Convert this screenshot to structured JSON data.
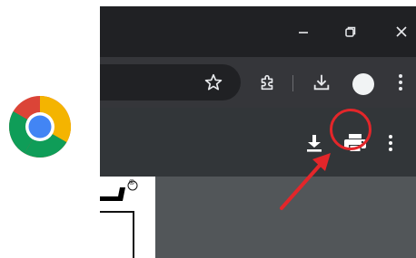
{
  "colors": {
    "title_bar": "#202124",
    "toolbar": "#35363a",
    "pdf_toolbar": "#323639",
    "viewer_background": "#525659",
    "annotation": "#e3262a",
    "icon": "#e8eaed"
  },
  "logo": {
    "icon": "chrome-logo"
  },
  "titlebar": {
    "buttons": [
      "minimize-icon",
      "restore-icon",
      "close-icon"
    ]
  },
  "toolbar": {
    "icons": [
      "star-icon",
      "puzzle-icon",
      "download-icon",
      "avatar",
      "kebab-menu-icon"
    ]
  },
  "pdf_toolbar": {
    "icons": [
      "download-icon",
      "print-icon",
      "kebab-menu-icon"
    ],
    "highlighted": "print-icon"
  },
  "annotation": {
    "shapes": [
      "circle-around-print",
      "arrow-pointing-to-print"
    ]
  },
  "document": {
    "registered_mark": "®"
  }
}
